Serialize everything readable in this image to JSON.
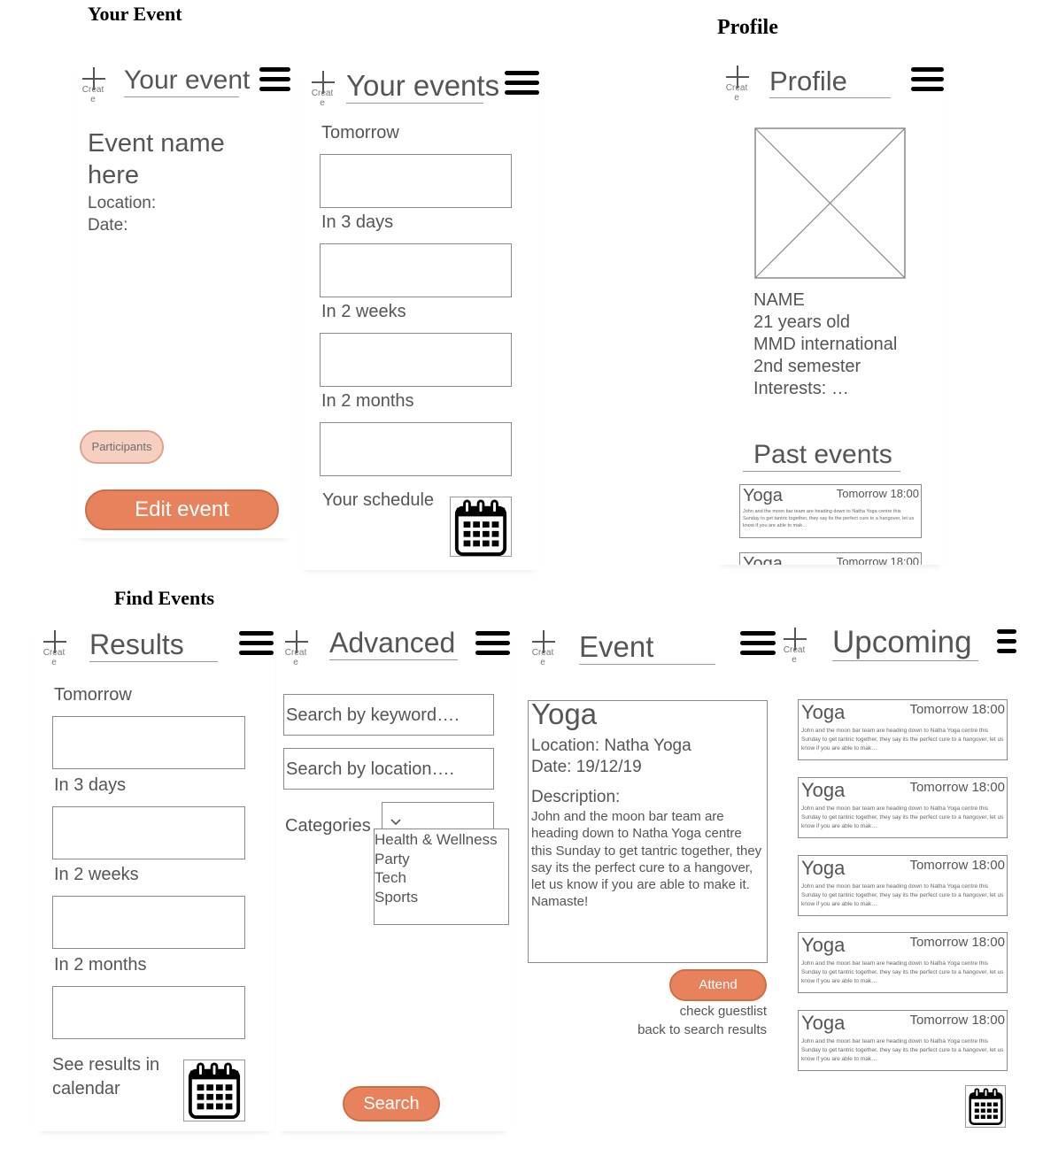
{
  "sections": {
    "your_event": "Your Event",
    "profile": "Profile",
    "find_events": "Find Events"
  },
  "create_label": "Creat e",
  "screens": {
    "your_event": {
      "title": "Your event",
      "event_name": "Event name here",
      "location": "Location:",
      "date": "Date:",
      "participants_button": "Participants",
      "edit_button": "Edit event"
    },
    "your_events": {
      "title": "Your events",
      "groups": [
        "Tomorrow",
        "In 3 days",
        "In 2 weeks",
        "In 2 months"
      ],
      "schedule": "Your schedule"
    },
    "profile": {
      "title": "Profile",
      "name": "NAME",
      "age": "21 years old",
      "program": "MMD international",
      "semester": "2nd semester",
      "interests": "Interests: …",
      "past_events_title": "Past events",
      "past_events": [
        {
          "title": "Yoga",
          "when": "Tomorrow 18:00",
          "desc": "John and the moon bar team are heading down to Natha Yoga centre this Sunday to get tantric together, they say its the perfect cure to a hangover, let us know if you are able to mak…"
        },
        {
          "title": "Yoga",
          "when": "Tomorrow 18:00",
          "desc": ""
        }
      ]
    },
    "results": {
      "title": "Results",
      "groups": [
        "Tomorrow",
        "In 3 days",
        "In 2 weeks",
        "In 2 months"
      ],
      "calendar_link": "See results in calendar"
    },
    "advanced": {
      "title": "Advanced",
      "keyword_placeholder": "Search by keyword….",
      "location_placeholder": "Search by location….",
      "categories_label": "Categories",
      "categories": [
        "Health & Wellness",
        "Party",
        "Tech",
        "Sports"
      ],
      "search_button": "Search"
    },
    "event": {
      "title": "Event",
      "event_title": "Yoga",
      "location": "Location: Natha Yoga",
      "date": "Date: 19/12/19",
      "description_label": "Description:",
      "description": "John and the moon bar team are heading down to Natha Yoga centre this Sunday to get tantric together, they say its the perfect cure to a hangover, let us know if you are able to make it. Namaste!",
      "attend_button": "Attend",
      "guestlist_link": "check guestlist",
      "back_link": "back to search results"
    },
    "upcoming": {
      "title": "Upcoming",
      "cards": [
        {
          "title": "Yoga",
          "when": "Tomorrow 18:00",
          "desc": "John and the moon bar team are heading down to Natha Yoga centre this Sunday to get tantric together, they say its the perfect cure to a hangover, let us know if you are able to mak…"
        },
        {
          "title": "Yoga",
          "when": "Tomorrow 18:00",
          "desc": "John and the moon bar team are heading down to Natha Yoga centre this Sunday to get tantric together, they say its the perfect cure to a hangover, let us know if you are able to mak…"
        },
        {
          "title": "Yoga",
          "when": "Tomorrow 18:00",
          "desc": "John and the moon bar team are heading down to Natha Yoga centre this Sunday to get tantric together, they say its the perfect cure to a hangover, let us know if you are able to mak…"
        },
        {
          "title": "Yoga",
          "when": "Tomorrow 18:00",
          "desc": "John and the moon bar team are heading down to Natha Yoga centre this Sunday to get tantric together, they say its the perfect cure to a hangover, let us know if you are able to mak…"
        },
        {
          "title": "Yoga",
          "when": "Tomorrow 18:00",
          "desc": "John and the moon bar team are heading down to Natha Yoga centre this Sunday to get tantric together, they say its the perfect cure to a hangover, let us know if you are able to mak…"
        }
      ]
    }
  },
  "colors": {
    "accent": "#e8825c",
    "accent_light": "#f6cfc0",
    "text": "#555555",
    "border": "#8a8a8a"
  }
}
